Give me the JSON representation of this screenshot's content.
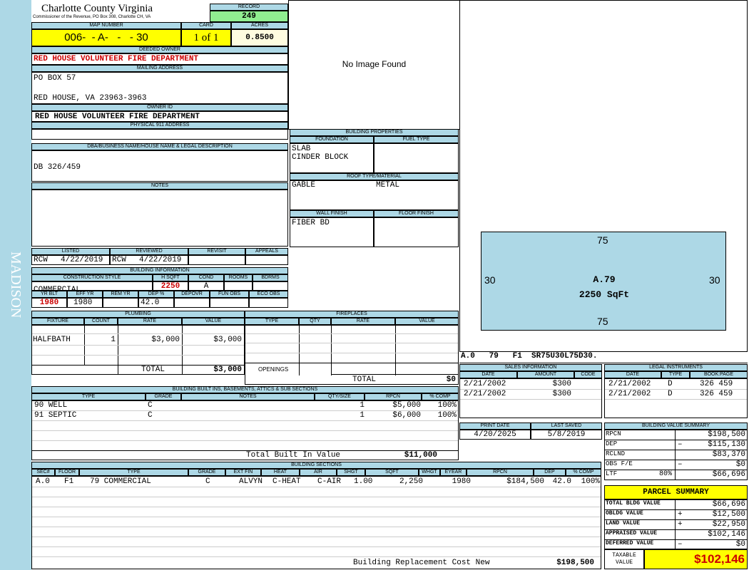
{
  "side_label": "MADISON",
  "header": {
    "county": "Charlotte County Virginia",
    "address": "Commissioner of the Revenue, PO Box 308, Charlotte CH, VA",
    "record_label": "RECORD",
    "record": "249",
    "map_label": "MAP NUMBER",
    "map_number": "006-  - A-   -   - 30",
    "card_label": "CARD",
    "card": "1 of 1",
    "acres_label": "ACRES",
    "acres": "0.8500"
  },
  "owner": {
    "deeded_label": "DEEDED OWNER",
    "deeded": "RED HOUSE VOLUNTEER FIRE DEPARTMENT",
    "mailing_label": "MAILING ADDRESS",
    "mailing_line1": "PO BOX 57",
    "mailing_line2": "",
    "mailing_line3": "RED HOUSE, VA 23963-3963",
    "owner_id_label": "OWNER ID",
    "owner_id": "RED HOUSE VOLUNTEER FIRE DEPARTMENT",
    "physical_label": "PHYSICAL 911 ADDRESS",
    "physical": ""
  },
  "dba": {
    "label": "DBA/BUSINESS NAME/HOUSE NAME & LEGAL DESCRIPTION",
    "text": "DB 326/459"
  },
  "notes": {
    "label": "NOTES",
    "text": ""
  },
  "review": {
    "listed_label": "LISTED",
    "listed_by": "RCW",
    "listed_date": "4/22/2019",
    "reviewed_label": "REVIEWED",
    "reviewed_by": "RCW",
    "reviewed_date": "4/22/2019",
    "revisit_label": "REVISIT",
    "appeals_label": "APPEALS"
  },
  "building_info": {
    "label": "BUILDING INFORMATION",
    "construction_label": "CONSTRUCTION STYLE",
    "construction": "COMMERCIAL",
    "hsqft_label": "H SQFT",
    "hsqft": "2250",
    "cond_label": "COND",
    "cond": "A",
    "rooms_label": "ROOMS",
    "bdrms_label": "BDRMS",
    "yrblt_label": "YR BLT",
    "yrblt": "1980",
    "effyr_label": "EFF YR",
    "effyr": "1980",
    "remyr_label": "REM YR",
    "dep_label": "DEP %",
    "dep": "42.0",
    "depovr_label": "DEPOVR",
    "funobs_label": "FUN OBS",
    "ecoobs_label": "ECO OBS"
  },
  "image": {
    "no_image": "No Image Found"
  },
  "building_props": {
    "label": "BUILDING PROPERTIES",
    "foundation_label": "FOUNDATION",
    "foundation1": "SLAB",
    "foundation2": "CINDER BLOCK",
    "fuel_label": "FUEL TYPE",
    "roof_label": "ROOF TYPE/MATERIAL",
    "roof_type": "GABLE",
    "roof_material": "METAL",
    "wall_label": "WALL FINISH",
    "wall": "FIBER BD",
    "floor_label": "FLOOR FINISH"
  },
  "sketch": {
    "top": "75",
    "bottom": "75",
    "left": "30",
    "right": "30",
    "area_label": "A.79",
    "area_sqft": "2250 SqFt",
    "caption": "A.0   79   F1  SR75U30L75D30."
  },
  "plumbing": {
    "label": "PLUMBING",
    "headers": [
      "FIXTURE",
      "COUNT",
      "RATE",
      "VALUE"
    ],
    "rows": [
      {
        "fixture": "HALFBATH",
        "count": "1",
        "rate": "$3,000",
        "value": "$3,000"
      }
    ],
    "total_label": "TOTAL",
    "total": "$3,000"
  },
  "fireplaces": {
    "label": "FIREPLACES",
    "headers": [
      "TYPE",
      "QTY",
      "RATE",
      "VALUE"
    ],
    "openings_label": "OPENINGS",
    "total_label": "TOTAL",
    "total": "$0"
  },
  "sales": {
    "label": "SALES INFORMATION",
    "headers": [
      "DATE",
      "AMOUNT",
      "CODE"
    ],
    "rows": [
      {
        "date": "2/21/2002",
        "amount": "$300",
        "code": ""
      },
      {
        "date": "2/21/2002",
        "amount": "$300",
        "code": ""
      }
    ]
  },
  "legal": {
    "label": "LEGAL INSTRUMENTS",
    "headers": [
      "DATE",
      "TYPE",
      "BOOK:PAGE"
    ],
    "rows": [
      {
        "date": "2/21/2002",
        "type": "D",
        "book": "326 459"
      },
      {
        "date": "2/21/2002",
        "type": "D",
        "book": "326 459"
      }
    ]
  },
  "print": {
    "print_label": "PRINT DATE",
    "print_date": "4/20/2025",
    "saved_label": "LAST SAVED",
    "saved_date": "5/8/2019"
  },
  "builtins": {
    "label": "BUILDING BUILT INS, BASEMENTS, ATTICS & SUB SECTIONS",
    "headers": [
      "TYPE",
      "GRADE",
      "NOTES",
      "QTY/SIZE",
      "RPCN",
      "% COMP"
    ],
    "rows": [
      {
        "type": "90 WELL",
        "grade": "C",
        "notes": "",
        "qty": "1",
        "rpcn": "$5,000",
        "comp": "100%"
      },
      {
        "type": "91 SEPTIC",
        "grade": "C",
        "notes": "",
        "qty": "1",
        "rpcn": "$6,000",
        "comp": "100%"
      }
    ],
    "total_label": "Total Built In Value",
    "total": "$11,000"
  },
  "value_summary": {
    "label": "BUILDING VALUE SUMMARY",
    "rows": [
      {
        "label": "RPCN",
        "sign": "",
        "value": "$198,500",
        "pct": ""
      },
      {
        "label": "DEP",
        "sign": "–",
        "value": "$115,130",
        "pct": ""
      },
      {
        "label": "RCLND",
        "sign": "",
        "value": "$83,370",
        "pct": ""
      },
      {
        "label": "OBS F/E",
        "sign": "–",
        "value": "$0",
        "pct": ""
      },
      {
        "label": "LTF",
        "sign": "",
        "value": "$66,696",
        "pct": "80%"
      }
    ]
  },
  "parcel": {
    "label": "PARCEL SUMMARY",
    "rows": [
      {
        "label": "TOTAL BLDG VALUE",
        "sign": "",
        "value": "$66,696"
      },
      {
        "label": "OBLDG VALUE",
        "sign": "+",
        "value": "$12,500"
      },
      {
        "label": "LAND VALUE",
        "sign": "+",
        "value": "$22,950"
      },
      {
        "label": "APPRAISED VALUE",
        "sign": "",
        "value": "$102,146"
      },
      {
        "label": "DEFERRED VALUE",
        "sign": "–",
        "value": "$0"
      }
    ],
    "taxable_label": "TAXABLE VALUE",
    "taxable": "$102,146"
  },
  "sections": {
    "label": "BUILDING SECTIONS",
    "headers": [
      "SEC#",
      "FLOOR",
      "TYPE",
      "GRADE",
      "EXT FIN",
      "HEAT",
      "AIR",
      "SHGT",
      "SQFT",
      "WHGT",
      "EYEAR",
      "RPCN",
      "DEP",
      "% COMP"
    ],
    "rows": [
      {
        "sec": "A.0",
        "floor": "F1",
        "type": "79 COMMERCIAL",
        "grade": "C",
        "extfin": "ALVYN",
        "heat": "C-HEAT",
        "air": "C-AIR",
        "shgt": "1.00",
        "sqft": "2,250",
        "whgt": "",
        "eyear": "1980",
        "rpcn": "$184,500",
        "dep": "42.0",
        "comp": "100%"
      }
    ],
    "rcn_label": "Building Replacement Cost New",
    "rcn": "$198,500"
  }
}
